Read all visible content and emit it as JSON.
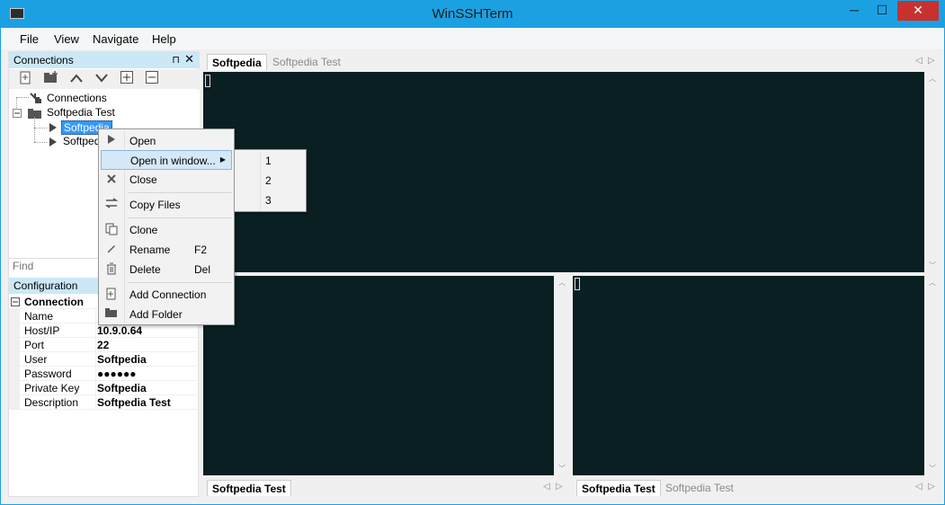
{
  "window": {
    "title": "WinSSHTerm",
    "minimize": "─",
    "maximize": "☐",
    "close": "✕"
  },
  "menu": [
    "File",
    "View",
    "Navigate",
    "Help"
  ],
  "connections_panel": {
    "title": "Connections",
    "pin": "⊓",
    "close": "✕",
    "tree": {
      "root": "Connections",
      "folder": "Softpedia Test",
      "children": [
        "Softpedia",
        "Softped"
      ]
    },
    "find_placeholder": "Find"
  },
  "config_panel": {
    "title": "Configuration",
    "section": "Connection",
    "rows": [
      {
        "label": "Name",
        "value": ""
      },
      {
        "label": "Host/IP",
        "value": "10.9.0.64"
      },
      {
        "label": "Port",
        "value": "22"
      },
      {
        "label": "User",
        "value": "Softpedia"
      },
      {
        "label": "Password",
        "value": "●●●●●●"
      },
      {
        "label": "Private Key",
        "value": "Softpedia"
      },
      {
        "label": "Description",
        "value": "Softpedia Test"
      }
    ]
  },
  "top_tabs": [
    {
      "label": "Softpedia",
      "active": true
    },
    {
      "label": "Softpedia Test",
      "active": false
    }
  ],
  "bottom_left_tabs": [
    {
      "label": "Softpedia Test",
      "active": true
    }
  ],
  "bottom_right_tabs": [
    {
      "label": "Softpedia Test",
      "active": true
    },
    {
      "label": "Softpedia Test",
      "active": false
    }
  ],
  "context_menu": {
    "items": [
      {
        "label": "Open",
        "shortcut": "",
        "icon": "play-icon"
      },
      {
        "label": "Open in window...",
        "shortcut": "",
        "icon": "",
        "submenu": true
      },
      {
        "label": "Close",
        "shortcut": "",
        "icon": "close-icon"
      },
      {
        "label": "Copy Files",
        "shortcut": "",
        "icon": "swap-icon"
      },
      {
        "label": "Clone",
        "shortcut": "",
        "icon": "clone-icon"
      },
      {
        "label": "Rename",
        "shortcut": "F2",
        "icon": "pencil-icon"
      },
      {
        "label": "Delete",
        "shortcut": "Del",
        "icon": "trash-icon"
      },
      {
        "label": "Add Connection",
        "shortcut": "",
        "icon": "add-file-icon"
      },
      {
        "label": "Add Folder",
        "shortcut": "",
        "icon": "add-folder-icon"
      }
    ],
    "submenu": [
      "1",
      "2",
      "3"
    ]
  },
  "colors": {
    "titlebar": "#1ba1e2",
    "terminal_bg": "#0a1f22",
    "panel_header": "#cbe8f6",
    "close_button": "#c7312e"
  }
}
